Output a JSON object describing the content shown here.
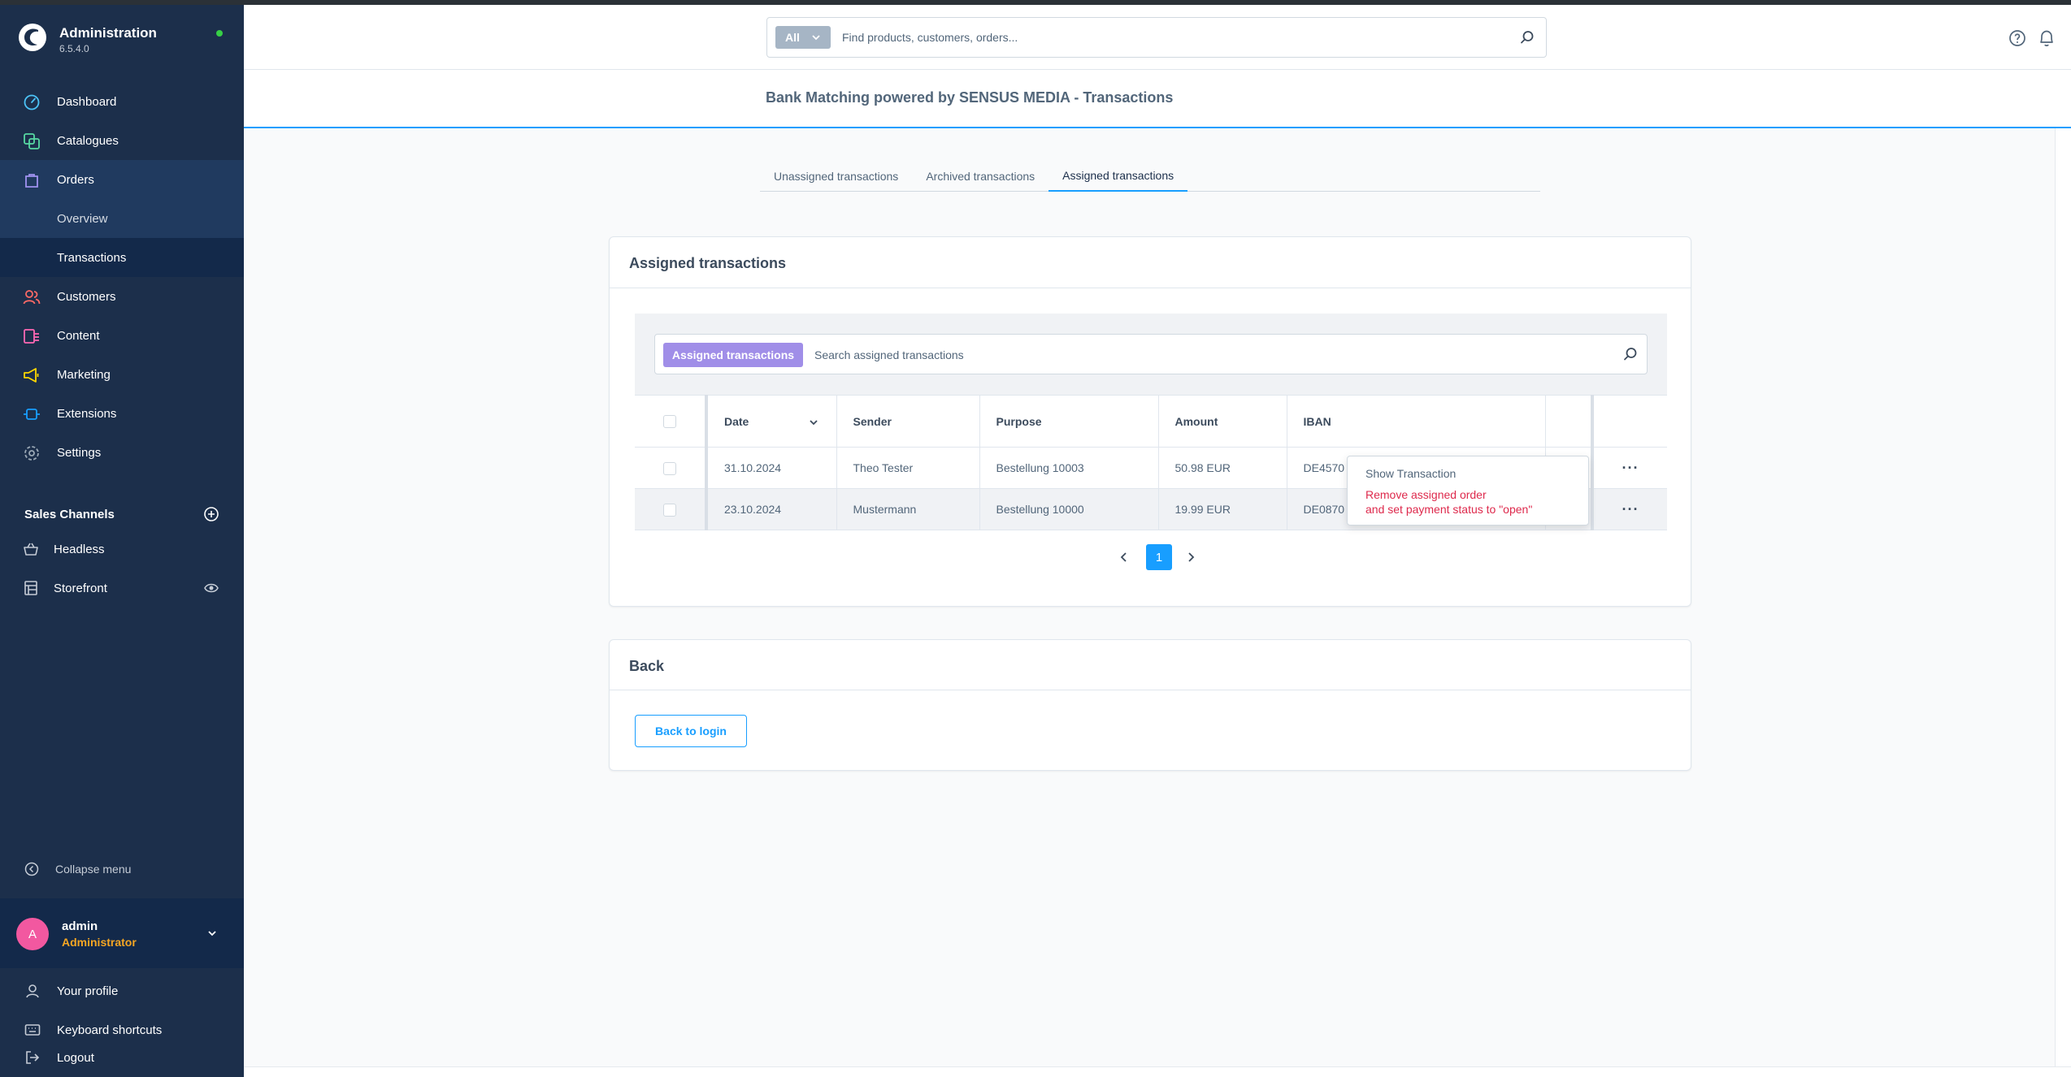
{
  "sidebar": {
    "app_title": "Administration",
    "version": "6.5.4.0",
    "nav": [
      {
        "label": "Dashboard",
        "icon": "dashboard-icon",
        "color": "#4cc3f7"
      },
      {
        "label": "Catalogues",
        "icon": "catalogue-icon",
        "color": "#57d9a3"
      },
      {
        "label": "Orders",
        "icon": "orders-icon",
        "color": "#a092f0"
      },
      {
        "label": "Customers",
        "icon": "customers-icon",
        "color": "#ff6a66"
      },
      {
        "label": "Content",
        "icon": "content-icon",
        "color": "#ff68b4"
      },
      {
        "label": "Marketing",
        "icon": "marketing-icon",
        "color": "#ffd700"
      },
      {
        "label": "Extensions",
        "icon": "extensions-icon",
        "color": "#189eff"
      },
      {
        "label": "Settings",
        "icon": "settings-icon",
        "color": "#9aa8b5"
      }
    ],
    "orders_sub": [
      {
        "label": "Overview"
      },
      {
        "label": "Transactions"
      }
    ],
    "sales_channels_title": "Sales Channels",
    "sales_channels": [
      {
        "label": "Headless",
        "icon": "basket-icon"
      },
      {
        "label": "Storefront",
        "icon": "storefront-icon"
      }
    ],
    "collapse_label": "Collapse menu",
    "user": {
      "initial": "A",
      "name": "admin",
      "role": "Administrator"
    },
    "bottom": [
      {
        "label": "Your profile",
        "icon": "profile-icon"
      },
      {
        "label": "Keyboard shortcuts",
        "icon": "keyboard-icon"
      },
      {
        "label": "Logout",
        "icon": "logout-icon"
      }
    ]
  },
  "header": {
    "search_type": "All",
    "search_placeholder": "Find products, customers, orders..."
  },
  "page": {
    "title": "Bank Matching powered by SENSUS MEDIA - Transactions",
    "tabs": [
      {
        "label": "Unassigned transactions",
        "active": false
      },
      {
        "label": "Archived transactions",
        "active": false
      },
      {
        "label": "Assigned transactions",
        "active": true
      }
    ]
  },
  "assigned_card": {
    "title": "Assigned transactions",
    "search_tag": "Assigned transactions",
    "search_placeholder": "Search assigned transactions",
    "columns": {
      "date": "Date",
      "sender": "Sender",
      "purpose": "Purpose",
      "amount": "Amount",
      "iban": "IBAN"
    },
    "rows": [
      {
        "date": "31.10.2024",
        "sender": "Theo Tester",
        "purpose": "Bestellung 10003",
        "amount": "50.98 EUR",
        "iban": "DE4570"
      },
      {
        "date": "23.10.2024",
        "sender": "Mustermann",
        "purpose": "Bestellung 10000",
        "amount": "19.99 EUR",
        "iban": "DE0870"
      }
    ],
    "actions_label": "···",
    "context_menu": {
      "show": "Show Transaction",
      "remove_line1": "Remove assigned order",
      "remove_line2": "and set payment status to \"open\""
    },
    "pagination": {
      "current": "1"
    }
  },
  "back_card": {
    "title": "Back",
    "button": "Back to login"
  }
}
